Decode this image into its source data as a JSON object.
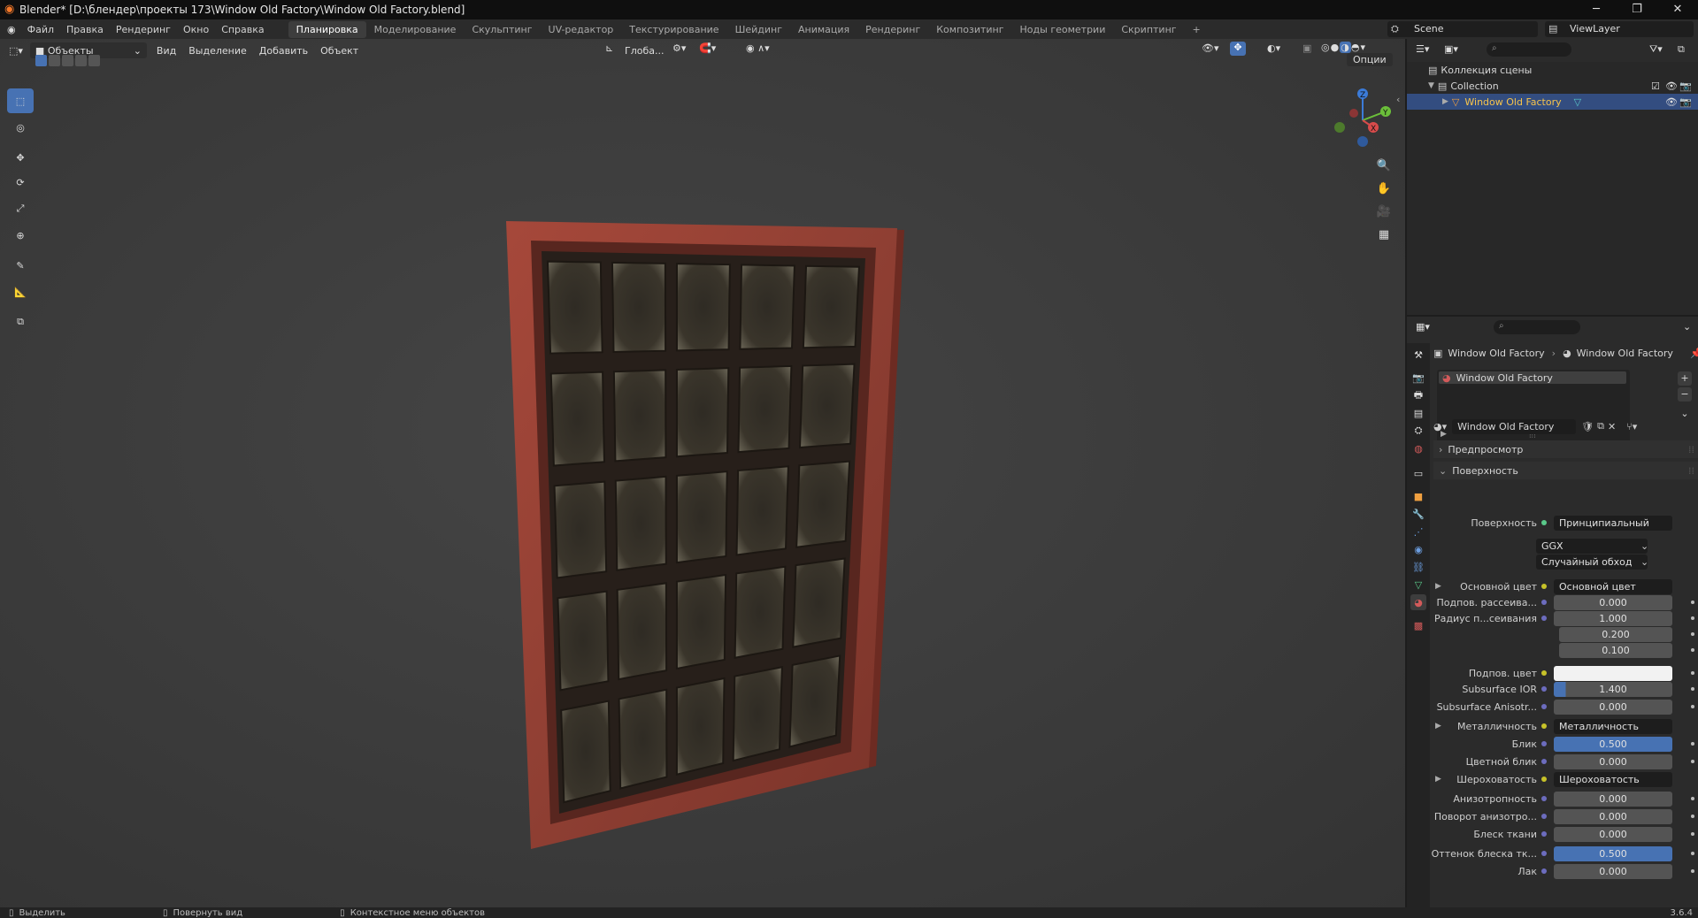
{
  "window": {
    "title": "Blender* [D:\\блендер\\проекты 173\\Window Old Factory\\Window Old Factory.blend]",
    "minimize": "─",
    "maximize": "❐",
    "close": "✕"
  },
  "menu": [
    "Файл",
    "Правка",
    "Рендеринг",
    "Окно",
    "Справка"
  ],
  "workspaces": [
    "Планировка",
    "Моделирование",
    "Скульптинг",
    "UV-редактор",
    "Текстурирование",
    "Шейдинг",
    "Анимация",
    "Рендеринг",
    "Композитинг",
    "Ноды геометрии",
    "Скриптинг"
  ],
  "workspace_add": "+",
  "scene": {
    "label": "Scene",
    "viewlayer": "ViewLayer"
  },
  "viewport": {
    "mode": "Объекты",
    "menus": [
      "Вид",
      "Выделение",
      "Добавить",
      "Объект"
    ],
    "orientation": "Глоба...",
    "options": "Опции",
    "gizmo": {
      "x": "X",
      "y": "Y",
      "z": "Z"
    }
  },
  "outliner": {
    "scene_collection": "Коллекция сцены",
    "collection": "Collection",
    "object": "Window Old Factory"
  },
  "properties": {
    "breadcrumb_object": "Window Old Factory",
    "breadcrumb_material": "Window Old Factory",
    "slot": "Window Old Factory",
    "material_name": "Window Old Factory",
    "panel_preview": "Предпросмотр",
    "panel_surface": "Поверхность",
    "surface_label": "Поверхность",
    "surface_value": "Принципиальный BSDF",
    "distribution": "GGX",
    "subsurface_method": "Случайный обход",
    "rows": [
      {
        "label": "Основной цвет",
        "value": "Основной цвет",
        "kind": "link",
        "expand": true
      },
      {
        "label": "Подпов. рассеива...",
        "value": "0.000",
        "kind": "num"
      },
      {
        "label": "Радиус п...сеивания",
        "value": "1.000",
        "kind": "num"
      },
      {
        "label": "",
        "value": "0.200",
        "kind": "num"
      },
      {
        "label": "",
        "value": "0.100",
        "kind": "num"
      },
      {
        "label": "Подпов. цвет",
        "value": "",
        "kind": "color"
      },
      {
        "label": "Subsurface IOR",
        "value": "1.400",
        "kind": "partial"
      },
      {
        "label": "Subsurface Anisotr...",
        "value": "0.000",
        "kind": "num"
      },
      {
        "label": "Металличность",
        "value": "Металличность",
        "kind": "link",
        "expand": true
      },
      {
        "label": "Блик",
        "value": "0.500",
        "kind": "blue"
      },
      {
        "label": "Цветной блик",
        "value": "0.000",
        "kind": "num"
      },
      {
        "label": "Шероховатость",
        "value": "Шероховатость",
        "kind": "link",
        "expand": true
      },
      {
        "label": "Анизотропность",
        "value": "0.000",
        "kind": "num"
      },
      {
        "label": "Поворот анизотро...",
        "value": "0.000",
        "kind": "num"
      },
      {
        "label": "Блеск ткани",
        "value": "0.000",
        "kind": "num"
      },
      {
        "label": "Оттенок блеска тк...",
        "value": "0.500",
        "kind": "blue"
      },
      {
        "label": "Лак",
        "value": "0.000",
        "kind": "num"
      }
    ]
  },
  "status": {
    "select": "Выделить",
    "rotate": "Повернуть вид",
    "context": "Контекстное меню объектов",
    "version": "3.6.4"
  }
}
